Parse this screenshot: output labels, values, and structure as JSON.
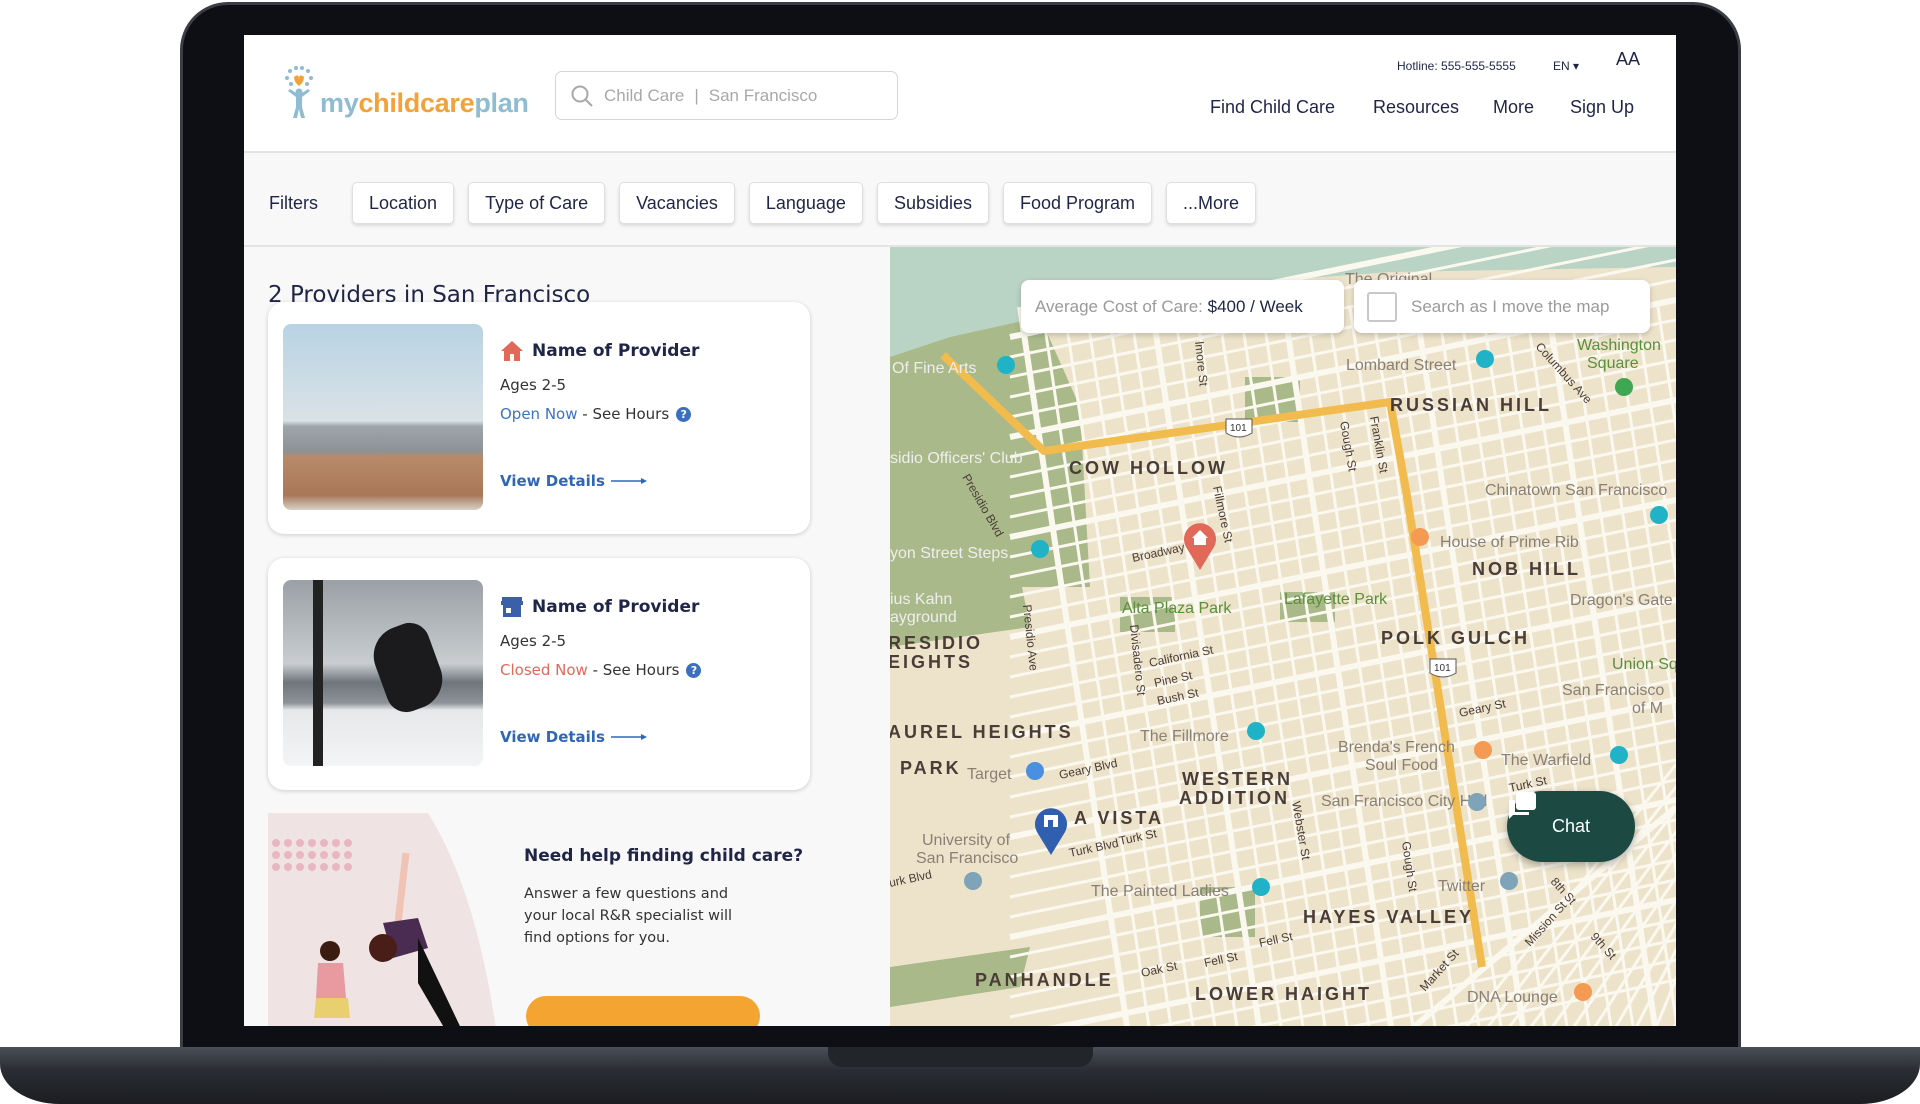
{
  "brand": {
    "logo_part1": "my",
    "logo_part2": "childcare",
    "logo_part3": "plan",
    "colors": {
      "navy": "#1f2547",
      "orange": "#f4a531",
      "light_blue": "#8fbcd0",
      "chat_green": "#1c4a43"
    }
  },
  "search": {
    "placeholder_type": "Child Care",
    "separator": "|",
    "placeholder_location": "San Francisco",
    "icon": "search-icon"
  },
  "header": {
    "hotline": "Hotline: 555-555-5555",
    "language": "EN",
    "text_size": "AA",
    "nav": [
      "Find Child Care",
      "Resources",
      "More",
      "Sign Up"
    ]
  },
  "filters": {
    "label": "Filters",
    "buttons": [
      "Location",
      "Type of Care",
      "Vacancies",
      "Language",
      "Subsidies",
      "Food Program",
      "...More"
    ]
  },
  "results": {
    "title": "2 Providers in San Francisco",
    "providers": [
      {
        "icon": "home-icon",
        "name": "Name of Provider",
        "ages": "Ages 2-5",
        "status": "Open Now",
        "status_color": "#3b73c4",
        "hours": " - See Hours",
        "details": "View Details"
      },
      {
        "icon": "storefront-icon",
        "name": "Name of Provider",
        "ages": "Ages 2-5",
        "status": "Closed Now",
        "status_color": "#e0695a",
        "hours": " - See Hours",
        "details": "View Details"
      }
    ]
  },
  "promo": {
    "title": "Need help finding child care?",
    "text": "Answer a few questions and your local R&R specialist will find options for you."
  },
  "map": {
    "avg_cost_label": "Average Cost of Care: ",
    "avg_cost_value": "$400 / Week",
    "search_toggle_label": "Search as I move the map",
    "search_toggle_checked": false,
    "chat_label": "Chat",
    "neighborhoods": [
      "COW HOLLOW",
      "RUSSIAN HILL",
      "NOB HILL",
      "POLK GULCH",
      "WESTERN",
      "ADDITION",
      "HAYES VALLEY",
      "LOWER HAIGHT",
      "PANHANDLE",
      "AUREL HEIGHTS",
      "RESIDIO",
      "EIGHTS",
      "PARK",
      "A VISTA"
    ],
    "parks": [
      "Alta Plaza Park",
      "Lafayette Park",
      "Washington",
      "Square",
      "Union Sq"
    ],
    "places": [
      "Lombard Street",
      "Chinatown San Francisco",
      "House of Prime Rib",
      "The Fillmore",
      "Brenda's French",
      "Soul Food",
      "The Warfield",
      "San Francisco City Hall",
      "Twitter",
      "The Painted Ladies",
      "DNA Lounge",
      "University of",
      "San Francisco",
      "Target",
      "sidio Officers' Club",
      "Of Fine Arts",
      "yon Street Steps",
      "ius Kahn",
      "ayground",
      "Dragon's Gate",
      "San Francisco",
      "of M",
      "The Original"
    ],
    "streets": [
      "Broadway",
      "Fillmore St",
      "Gough St",
      "Franklin St",
      "California St",
      "Pine St",
      "Bush St",
      "Geary Blvd",
      "Geary St",
      "Turk St",
      "Turk Blvd",
      "Webster St",
      "Fell St",
      "Oak St",
      "Market St",
      "Mission St",
      "8th St",
      "9th St",
      "Columbus Ave",
      "Presidio Blvd",
      "Presidio Ave",
      "Divisadero St",
      "lmore St",
      "urk Blvd",
      "Turk St",
      "Gough St",
      "Fell St"
    ],
    "highway_shield": "101"
  }
}
